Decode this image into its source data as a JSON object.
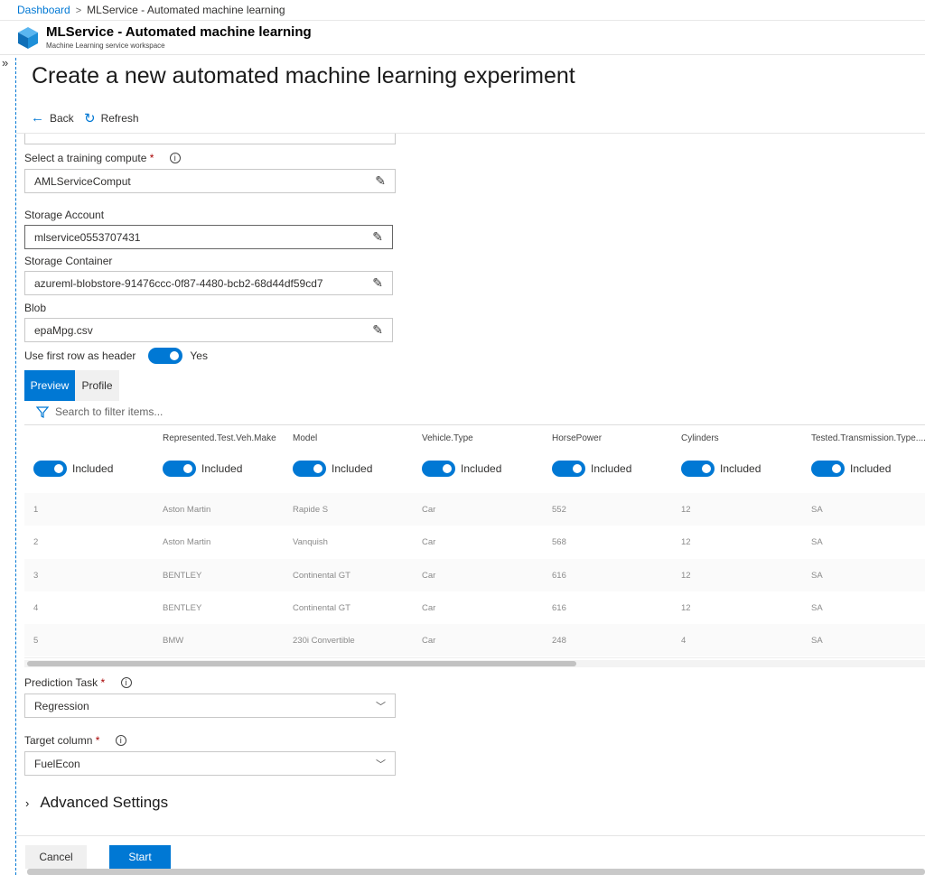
{
  "breadcrumb": {
    "home": "Dashboard",
    "current": "MLService - Automated machine learning"
  },
  "resource": {
    "title": "MLService - Automated machine learning",
    "subtitle": "Machine Learning service workspace"
  },
  "page_title": "Create a new automated machine learning experiment",
  "commands": {
    "back": "Back",
    "refresh": "Refresh"
  },
  "form": {
    "compute": {
      "label": "Select a training compute",
      "required": "*",
      "value": "AMLServiceComput"
    },
    "storage_account": {
      "label": "Storage Account",
      "value": "mlservice0553707431"
    },
    "storage_container": {
      "label": "Storage Container",
      "value": "azureml-blobstore-91476ccc-0f87-4480-bcb2-68d44df59cd7"
    },
    "blob": {
      "label": "Blob",
      "value": "epaMpg.csv"
    },
    "header_toggle": {
      "label": "Use first row as header",
      "value": "Yes",
      "on": true
    }
  },
  "tabs": {
    "preview": "Preview",
    "profile": "Profile"
  },
  "filter": {
    "placeholder": "Search to filter items..."
  },
  "table": {
    "columns": [
      "",
      "Represented.Test.Veh.Make",
      "Model",
      "Vehicle.Type",
      "HorsePower",
      "Cylinders",
      "Tested.Transmission.Type...."
    ],
    "included_label": "Included",
    "rows": [
      [
        "1",
        "Aston Martin",
        "Rapide S",
        "Car",
        "552",
        "12",
        "SA"
      ],
      [
        "2",
        "Aston Martin",
        "Vanquish",
        "Car",
        "568",
        "12",
        "SA"
      ],
      [
        "3",
        "BENTLEY",
        "Continental GT",
        "Car",
        "616",
        "12",
        "SA"
      ],
      [
        "4",
        "BENTLEY",
        "Continental GT",
        "Car",
        "616",
        "12",
        "SA"
      ],
      [
        "5",
        "BMW",
        "230i Convertible",
        "Car",
        "248",
        "4",
        "SA"
      ]
    ]
  },
  "prediction": {
    "label": "Prediction Task",
    "required": "*",
    "value": "Regression"
  },
  "target": {
    "label": "Target column",
    "required": "*",
    "value": "FuelEcon"
  },
  "advanced": {
    "label": "Advanced Settings"
  },
  "footer": {
    "cancel": "Cancel",
    "start": "Start"
  },
  "icons": {
    "back": "arrow-left-icon",
    "refresh": "refresh-icon",
    "edit": "pencil-icon",
    "info": "info-icon",
    "filter": "filter-icon"
  },
  "colors": {
    "accent": "#0078d4",
    "required": "#a80000"
  }
}
